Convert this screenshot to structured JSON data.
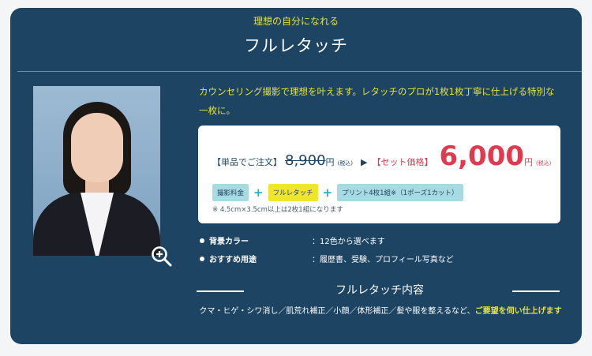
{
  "header": {
    "subtitle": "理想の自分になれる",
    "title": "フルレタッチ"
  },
  "photo": {
    "alt": "portrait photo of woman in suit",
    "zoom_icon": "zoom-in-icon"
  },
  "description": "カウンセリング撮影で理想を叶えます。レタッチのプロが1枚1枚丁寧に仕上げる特別な一枚に。",
  "price": {
    "single_label": "【単品でご注文】",
    "single_price": "8,900",
    "yen": "円",
    "tax": "(税込)",
    "arrow": "▶",
    "set_label": "【セット価格】",
    "set_price": "6,000"
  },
  "set_items": [
    "撮影料金",
    "フルレタッチ",
    "プリント4枚1組※（1ポーズ1カット）"
  ],
  "plus": "+",
  "note": "※ 4.5cm×3.5cm以上は2枚1組になります",
  "info": [
    {
      "key": "背景カラー",
      "value": "：12色から選べます"
    },
    {
      "key": "おすすめ用途",
      "value": "：履歴書、受験、プロフィール写真など"
    }
  ],
  "section": {
    "title": "フルレタッチ内容",
    "text": "クマ・ヒゲ・シワ消し／肌荒れ補正／小顔／体形補正／髪や服を整えるなど、",
    "highlight": "ご要望を伺い仕上げます"
  },
  "colors": {
    "panel": "#1d4463",
    "accent_yellow": "#e6e33c",
    "price_red": "#e03a4e",
    "tag_blue": "#a6dbe2"
  }
}
